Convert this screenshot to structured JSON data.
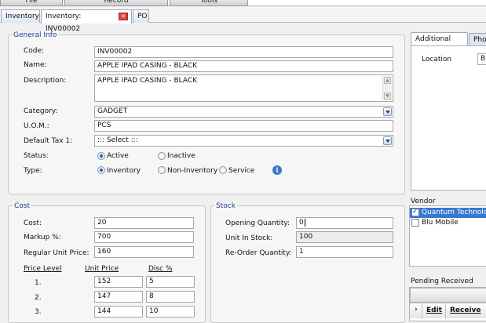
{
  "menu": {
    "file": "File",
    "record": "Record",
    "tools": "Tools"
  },
  "tabs": [
    {
      "label": "Inventory"
    },
    {
      "label": "Inventory: INV00002"
    },
    {
      "label": "PO"
    }
  ],
  "general": {
    "legend": "General Info",
    "code_label": "Code:",
    "code": "INV00002",
    "name_label": "Name:",
    "name": "APPLE IPAD CASING - BLACK",
    "desc_label": "Description:",
    "desc": "APPLE IPAD CASING - BLACK",
    "category_label": "Category:",
    "category": "GADGET",
    "uom_label": "U.O.M.:",
    "uom": "PCS",
    "tax_label": "Default Tax 1:",
    "tax": "::: Select :::",
    "status_label": "Status:",
    "status_active": "Active",
    "status_inactive": "Inactive",
    "type_label": "Type:",
    "type_inventory": "Inventory",
    "type_noninventory": "Non-Inventory",
    "type_service": "Service"
  },
  "cost": {
    "legend": "Cost",
    "cost_label": "Cost:",
    "cost": "20",
    "markup_label": "Markup %:",
    "markup": "700",
    "regular_label": "Regular Unit Price:",
    "regular": "160",
    "col_level": "Price Level",
    "col_unit": "Unit Price",
    "col_disc": "Disc %",
    "rows": [
      {
        "level": "1.",
        "unit": "152",
        "disc": "5"
      },
      {
        "level": "2.",
        "unit": "147",
        "disc": "8"
      },
      {
        "level": "3.",
        "unit": "144",
        "disc": "10"
      }
    ]
  },
  "stock": {
    "legend": "Stock",
    "opening_label": "Opening Quantity:",
    "opening": "0",
    "instock_label": "Unit In Stock:",
    "instock": "100",
    "reorder_label": "Re-Order Quantity:",
    "reorder": "1"
  },
  "right": {
    "tab_additional": "Additional Info",
    "tab_photo": "Photo",
    "location_label": "Location",
    "location": "BI",
    "vendor_title": "Vendor",
    "vendors": [
      {
        "name": "Quantum Technologie",
        "checked": true
      },
      {
        "name": "Blu Mobile",
        "checked": false
      }
    ],
    "pending_title": "Pending Received",
    "col_edit": "Edit",
    "col_receive": "Receive",
    "row_arrow": "›"
  }
}
